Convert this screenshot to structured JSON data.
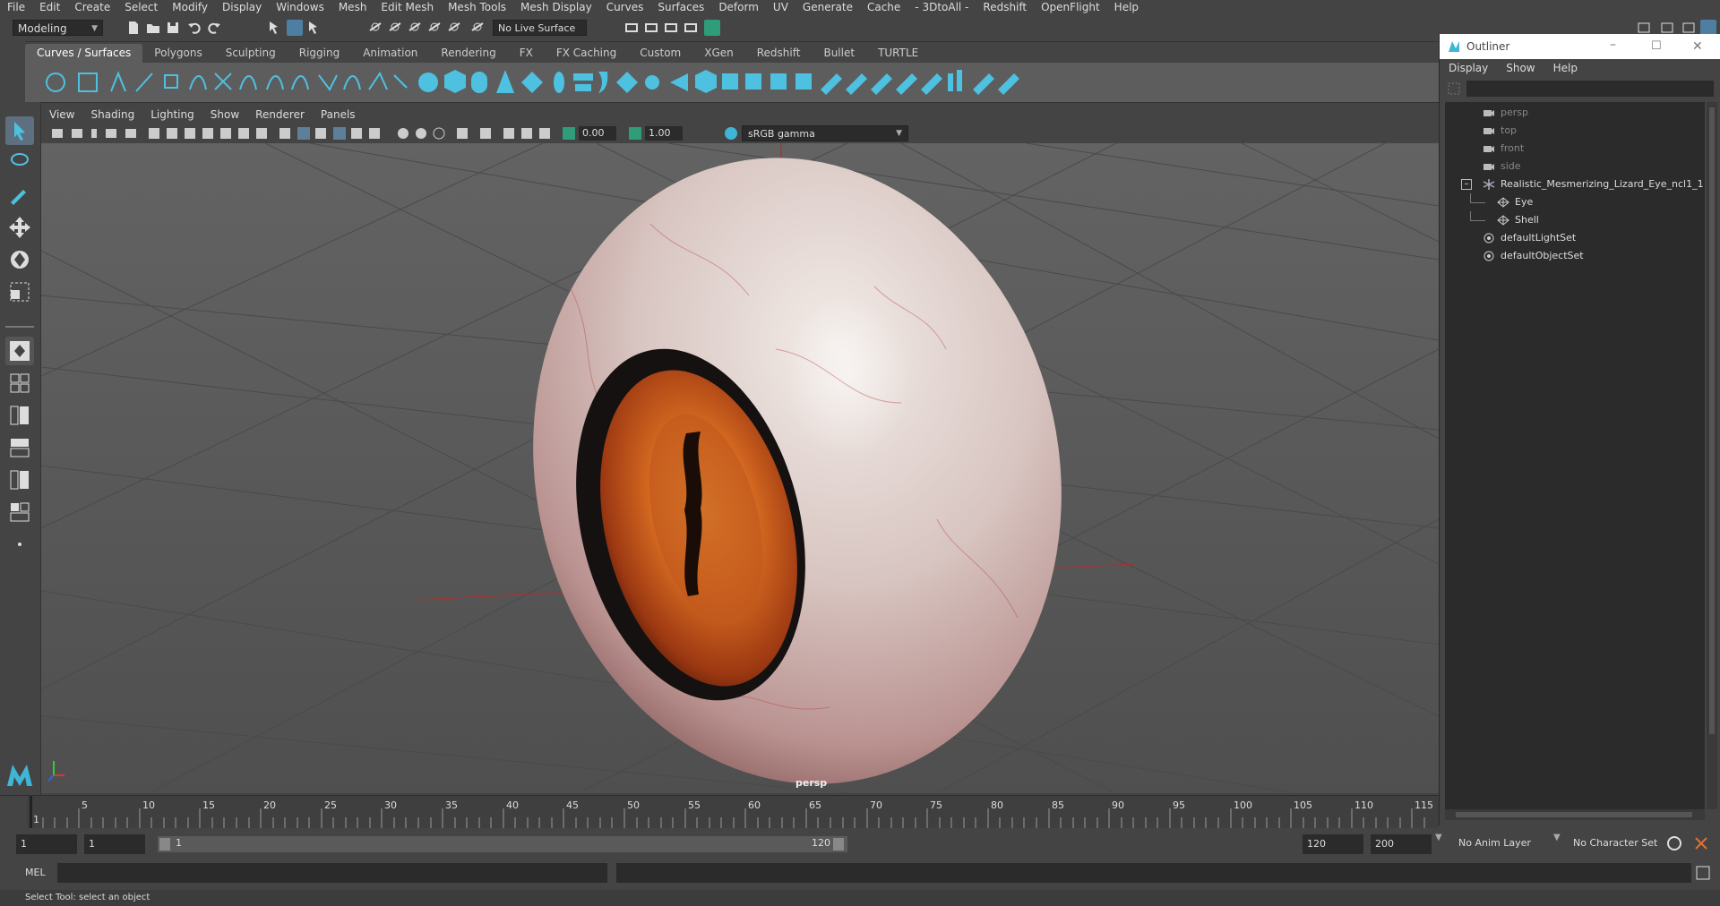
{
  "menubar": {
    "items": [
      "File",
      "Edit",
      "Create",
      "Select",
      "Modify",
      "Display",
      "Windows",
      "Mesh",
      "Edit Mesh",
      "Mesh Tools",
      "Mesh Display",
      "Curves",
      "Surfaces",
      "Deform",
      "UV",
      "Generate",
      "Cache",
      "- 3DtoAll -",
      "Redshift",
      "OpenFlight",
      "Help"
    ]
  },
  "statusline": {
    "mode": "Modeling",
    "live_surface": "No Live Surface"
  },
  "shelf": {
    "tabs": [
      "Curves / Surfaces",
      "Polygons",
      "Sculpting",
      "Rigging",
      "Animation",
      "Rendering",
      "FX",
      "FX Caching",
      "Custom",
      "XGen",
      "Redshift",
      "Bullet",
      "TURTLE"
    ],
    "active_tab": 0
  },
  "viewport": {
    "menu": [
      "View",
      "Shading",
      "Lighting",
      "Show",
      "Renderer",
      "Panels"
    ],
    "exposure": "0.00",
    "gamma_value": "1.00",
    "color_space": "sRGB gamma",
    "camera_label": "persp"
  },
  "timeslider": {
    "ticks": [
      "1",
      "5",
      "10",
      "15",
      "20",
      "25",
      "30",
      "35",
      "40",
      "45",
      "50",
      "55",
      "60",
      "65",
      "70",
      "75",
      "80",
      "85",
      "90",
      "95",
      "100",
      "105",
      "110",
      "115"
    ],
    "current_frame": "1"
  },
  "range": {
    "start": "1",
    "playback_start": "1",
    "range_start_label": "1",
    "range_end_label": "120",
    "playback_end": "120",
    "end": "200",
    "anim_layer": "No Anim Layer",
    "character_set": "No Character Set"
  },
  "cmdline": {
    "label": "MEL"
  },
  "helpline": {
    "text": "Select Tool: select an object"
  },
  "outliner": {
    "title": "Outliner",
    "menu": [
      "Display",
      "Show",
      "Help"
    ],
    "items": [
      {
        "label": "persp",
        "dim": true,
        "icon": "camera-icon",
        "indent": 0
      },
      {
        "label": "top",
        "dim": true,
        "icon": "camera-icon",
        "indent": 0
      },
      {
        "label": "front",
        "dim": true,
        "icon": "camera-icon",
        "indent": 0
      },
      {
        "label": "side",
        "dim": true,
        "icon": "camera-icon",
        "indent": 0
      },
      {
        "label": "Realistic_Mesmerizing_Lizard_Eye_ncl1_1",
        "dim": false,
        "icon": "transform-icon",
        "indent": 0
      },
      {
        "label": "Eye",
        "dim": false,
        "icon": "mesh-icon",
        "indent": 1
      },
      {
        "label": "Shell",
        "dim": false,
        "icon": "mesh-icon",
        "indent": 1
      },
      {
        "label": "defaultLightSet",
        "dim": false,
        "icon": "set-icon",
        "indent": 0
      },
      {
        "label": "defaultObjectSet",
        "dim": false,
        "icon": "set-icon",
        "indent": 0
      }
    ]
  },
  "colors": {
    "ui_dark": "#444444",
    "viewport_bg": "#5f5f5f",
    "accent_cyan": "#3fb6d6",
    "iris_orange": "#d2601c",
    "sclera": "#d9c8c6"
  }
}
